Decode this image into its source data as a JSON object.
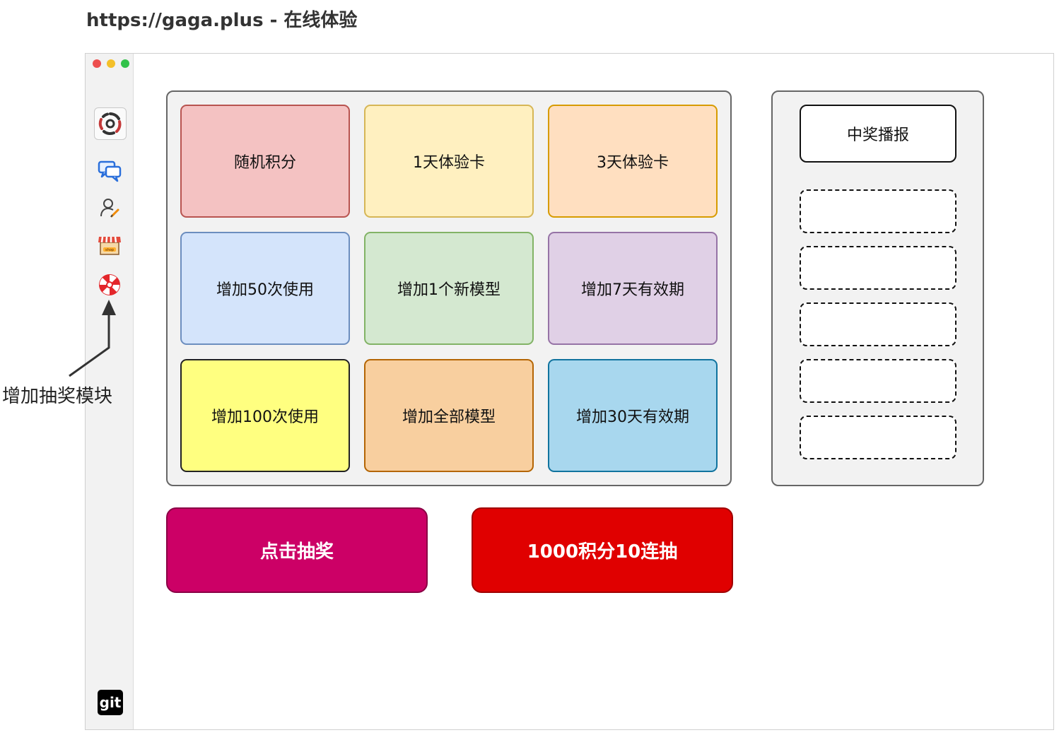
{
  "page_title": "https://gaga.plus - 在线体验",
  "annotation": {
    "label": "增加抽奖模块"
  },
  "sidebar": {
    "items": [
      {
        "icon": "ai-logo-icon"
      },
      {
        "icon": "chat-icon"
      },
      {
        "icon": "user-edit-icon"
      },
      {
        "icon": "shop-icon"
      },
      {
        "icon": "lottery-wheel-icon"
      }
    ],
    "footer_icon_label": "git"
  },
  "prizes": [
    {
      "label": "随机积分",
      "bg": "#f4c2c2",
      "border": "#b85450"
    },
    {
      "label": "1天体验卡",
      "bg": "#fff0c0",
      "border": "#d6b656"
    },
    {
      "label": "3天体验卡",
      "bg": "#ffdfc0",
      "border": "#d79b00"
    },
    {
      "label": "增加50次使用",
      "bg": "#d4e4fb",
      "border": "#6c8ebf"
    },
    {
      "label": "增加1个新模型",
      "bg": "#d4e8d0",
      "border": "#82b366"
    },
    {
      "label": "增加7天有效期",
      "bg": "#e0d0e6",
      "border": "#9673a6"
    },
    {
      "label": "增加100次使用",
      "bg": "#ffff80",
      "border": "#222222"
    },
    {
      "label": "增加全部模型",
      "bg": "#f8cf9f",
      "border": "#b46504"
    },
    {
      "label": "增加30天有效期",
      "bg": "#a8d7ee",
      "border": "#10739e"
    }
  ],
  "broadcast": {
    "title": "中奖播报",
    "slots": 5
  },
  "actions": {
    "draw_label": "点击抽奖",
    "draw_color": "#cc0066",
    "multi_draw_label": "1000积分10连抽",
    "multi_draw_color": "#e00000"
  }
}
